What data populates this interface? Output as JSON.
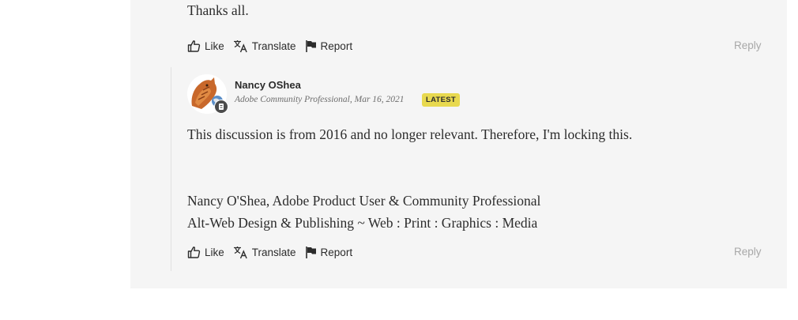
{
  "reply1": {
    "body": "Thanks all.",
    "actions": {
      "like": "Like",
      "translate": "Translate",
      "report": "Report",
      "reply": "Reply"
    }
  },
  "reply2": {
    "author": "Nancy OShea",
    "role": "Adobe Community Professional",
    "date": ", Mar 16, 2021",
    "badge": "LATEST",
    "body": "This discussion is from 2016 and no longer relevant.  Therefore, I'm locking this.",
    "signature_line1": "Nancy O'Shea, Adobe Product User & Community Professional",
    "signature_line2": "Alt-Web Design & Publishing ~ Web : Print : Graphics : Media",
    "actions": {
      "like": "Like",
      "translate": "Translate",
      "report": "Report",
      "reply": "Reply"
    }
  },
  "icons": {
    "like": "thumbs-up-icon",
    "translate": "translate-icon",
    "report": "flag-icon",
    "avatar_badge": "community-professional-badge-icon"
  },
  "colors": {
    "panel_bg": "#f5f5f5",
    "latest_badge": "#e8d94f",
    "reply_link": "#a8a8a8"
  }
}
